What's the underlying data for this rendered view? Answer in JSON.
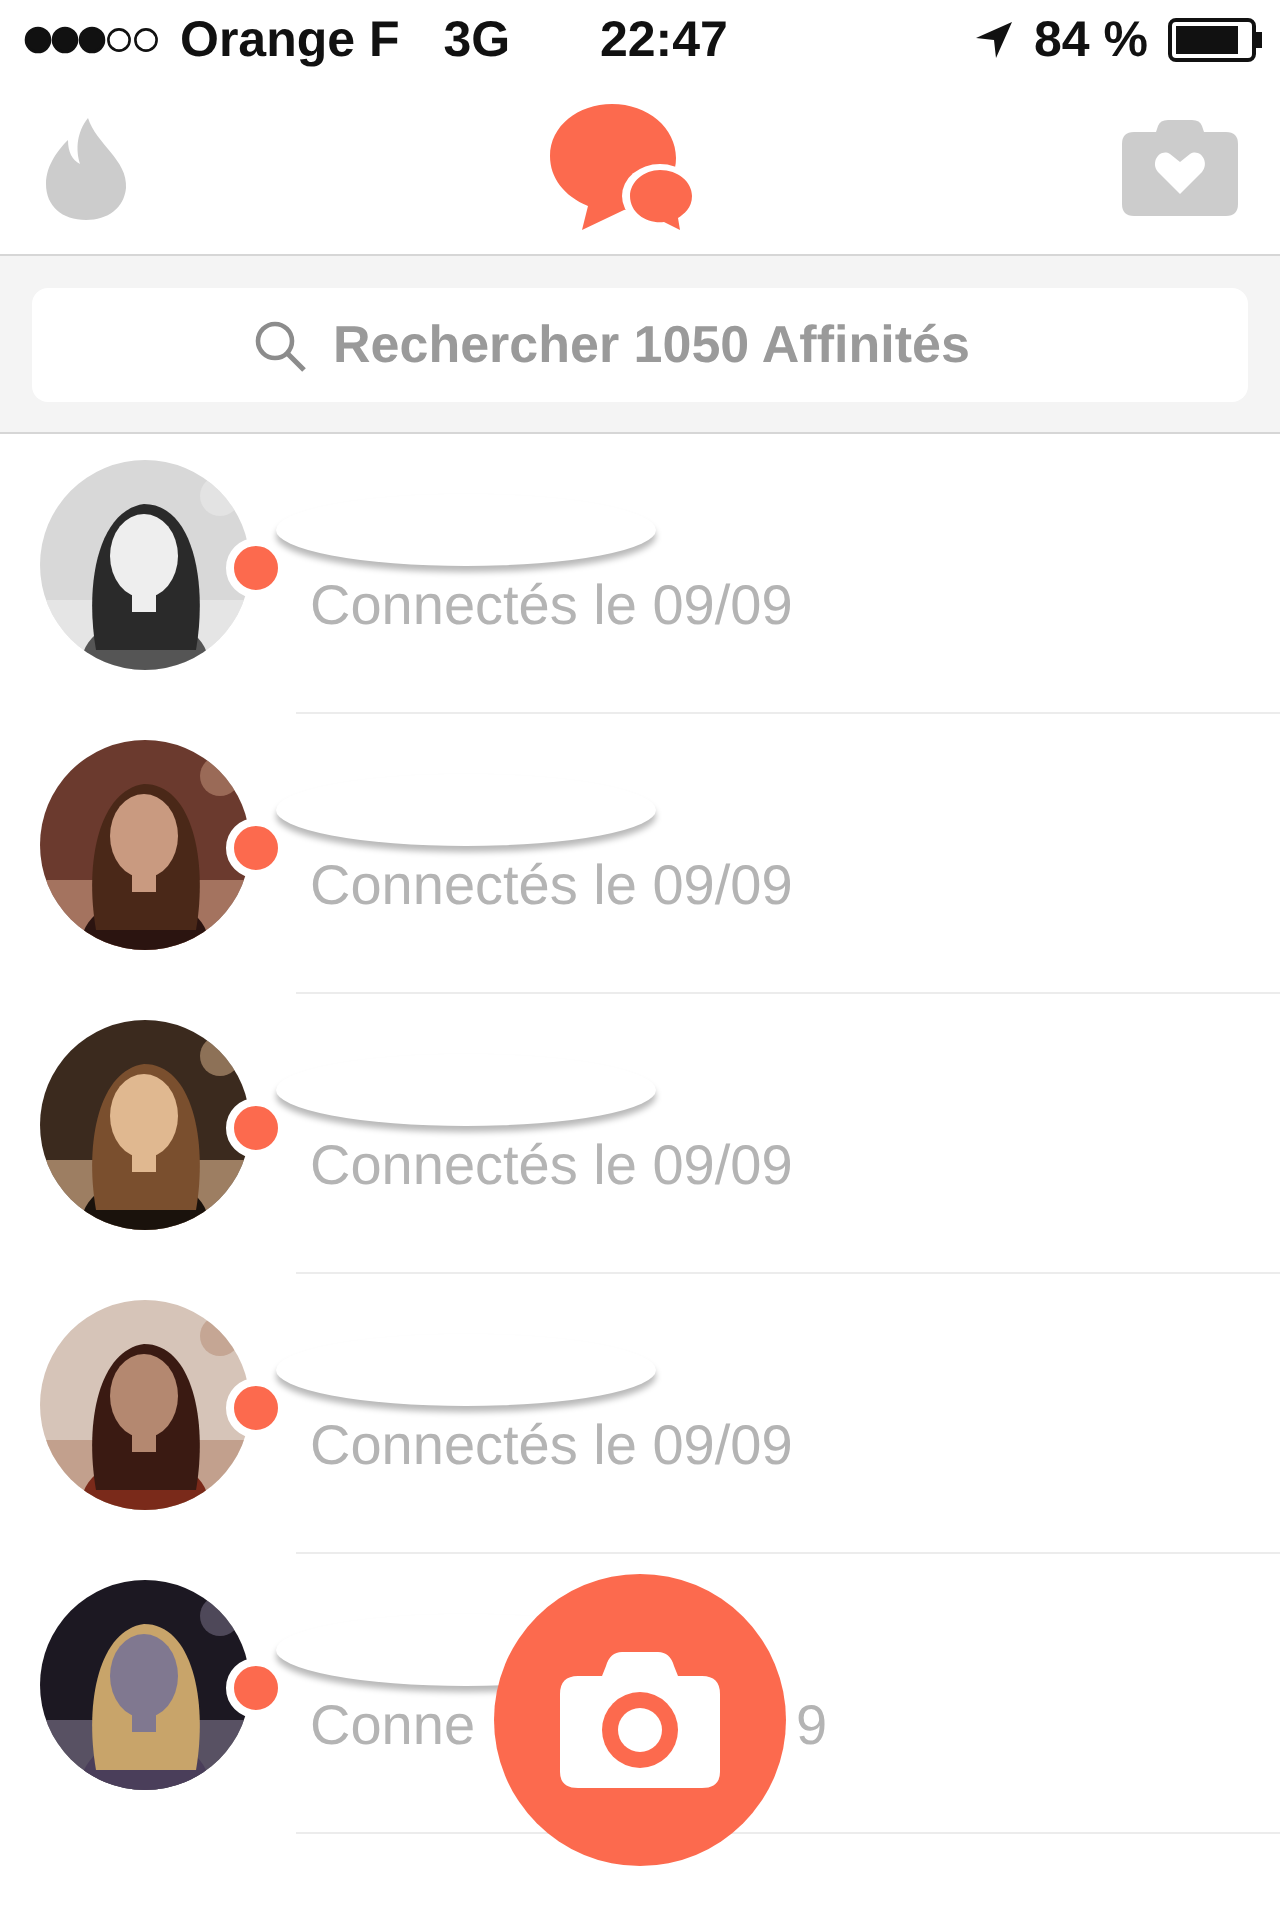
{
  "status_bar": {
    "carrier": "Orange F",
    "network": "3G",
    "time": "22:47",
    "battery_text": "84 %"
  },
  "tabs": [
    {
      "kind": "flame",
      "selected": false
    },
    {
      "kind": "chat",
      "selected": true
    },
    {
      "kind": "camera",
      "selected": false
    }
  ],
  "search": {
    "placeholder": "Rechercher 1050 Affinités"
  },
  "matches": [
    {
      "online": true,
      "name_hidden": true,
      "status": "Connectés le 09/09"
    },
    {
      "online": true,
      "name_hidden": true,
      "status": "Connectés le 09/09"
    },
    {
      "online": true,
      "name_hidden": true,
      "status": "Connectés le 09/09"
    },
    {
      "online": true,
      "name_hidden": true,
      "status": "Connectés le 09/09"
    },
    {
      "online": true,
      "name_hidden": true,
      "status_start": "Conne",
      "status_end": "9"
    }
  ],
  "camera_button": {
    "visible": true
  }
}
